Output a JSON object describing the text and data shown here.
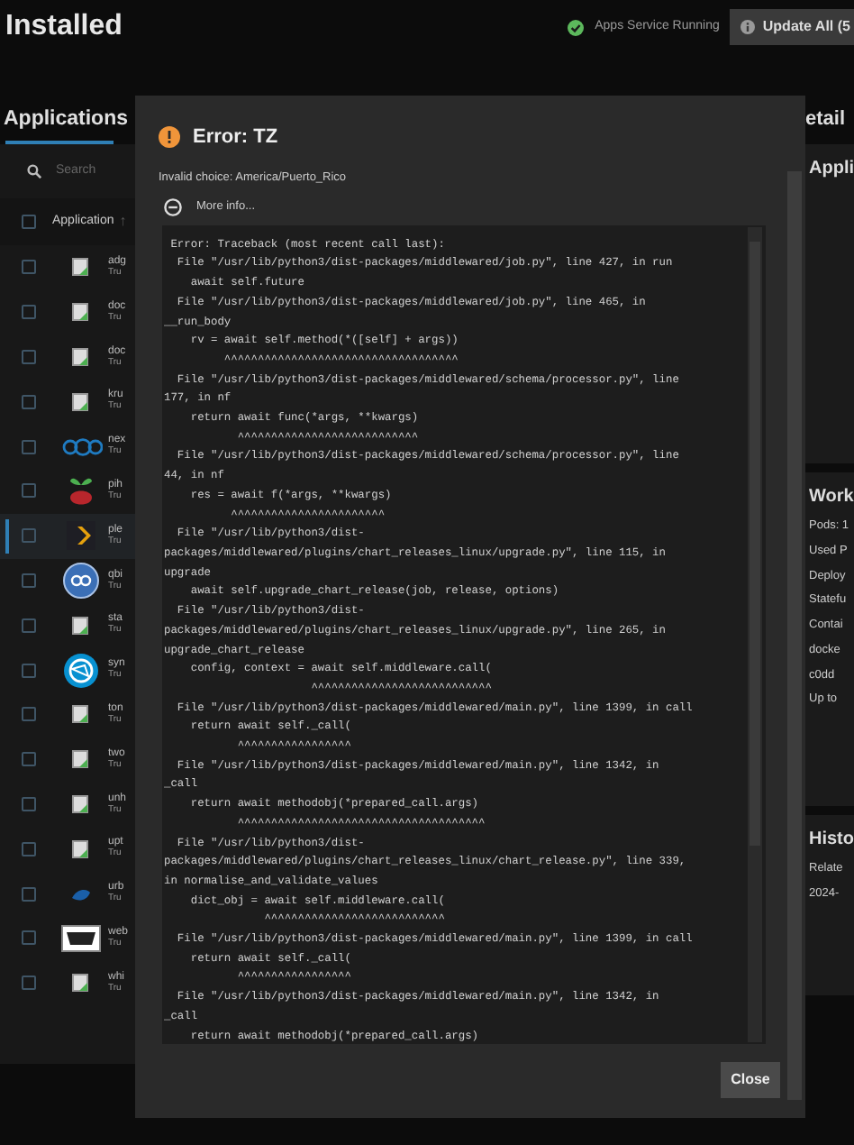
{
  "header": {
    "title": "Installed",
    "service_status": "Apps Service Running",
    "update_button": "Update All (5"
  },
  "applications": {
    "title": "Applications",
    "search": {
      "placeholder": "Search"
    },
    "select_all_checked": false,
    "column": "Application",
    "sort_icon": "↑",
    "rows": [
      {
        "name": "adg",
        "sub": "Tru",
        "kind": "broken",
        "checked": false,
        "selected": false
      },
      {
        "name": "doc",
        "sub": "Tru",
        "kind": "broken",
        "checked": false,
        "selected": false
      },
      {
        "name": "doc",
        "sub": "Tru",
        "kind": "broken",
        "checked": false,
        "selected": false
      },
      {
        "name": "kru",
        "sub": "Tru",
        "kind": "broken",
        "checked": false,
        "selected": false
      },
      {
        "name": "nex",
        "sub": "Tru",
        "kind": "rings",
        "checked": false,
        "selected": false
      },
      {
        "name": "pih",
        "sub": "Tru",
        "kind": "fruit",
        "checked": false,
        "selected": false
      },
      {
        "name": "ple",
        "sub": "Tru",
        "kind": "chevron",
        "checked": false,
        "selected": true
      },
      {
        "name": "qbi",
        "sub": "Tru",
        "kind": "bluecircle",
        "checked": false,
        "selected": false
      },
      {
        "name": "sta",
        "sub": "Tru",
        "kind": "broken",
        "checked": false,
        "selected": false
      },
      {
        "name": "syn",
        "sub": "Tru",
        "kind": "network",
        "checked": false,
        "selected": false
      },
      {
        "name": "ton",
        "sub": "Tru",
        "kind": "broken",
        "checked": false,
        "selected": false
      },
      {
        "name": "two",
        "sub": "Tru",
        "kind": "broken",
        "checked": false,
        "selected": false
      },
      {
        "name": "unh",
        "sub": "Tru",
        "kind": "broken",
        "checked": false,
        "selected": false
      },
      {
        "name": "upt",
        "sub": "Tru",
        "kind": "broken",
        "checked": false,
        "selected": false
      },
      {
        "name": "urb",
        "sub": "Tru",
        "kind": "leaf",
        "checked": false,
        "selected": false
      },
      {
        "name": "web",
        "sub": "Tru",
        "kind": "box",
        "checked": false,
        "selected": false
      },
      {
        "name": "whi",
        "sub": "Tru",
        "kind": "broken",
        "checked": false,
        "selected": false
      }
    ]
  },
  "details": {
    "title": "etail",
    "cards": [
      {
        "title": "Appli"
      },
      {
        "title": "Work",
        "lines": [
          "Pods: 1",
          "Used P",
          "Deploy",
          "Statefu",
          "Contai",
          "docke",
          "c0dd",
          "Up to"
        ]
      },
      {
        "title": "Histo",
        "lines": [
          "Relate",
          "2024-"
        ]
      }
    ]
  },
  "dialog": {
    "title": "Error: TZ",
    "message": "Invalid choice: America/Puerto_Rico",
    "more_info": "More info...",
    "close_button": "Close",
    "traceback": [
      " Error: Traceback (most recent call last):",
      "  File \"/usr/lib/python3/dist-packages/middlewared/job.py\", line 427, in run",
      "    await self.future",
      "  File \"/usr/lib/python3/dist-packages/middlewared/job.py\", line 465, in",
      "__run_body",
      "    rv = await self.method(*([self] + args))",
      "         ^^^^^^^^^^^^^^^^^^^^^^^^^^^^^^^^^^^",
      "  File \"/usr/lib/python3/dist-packages/middlewared/schema/processor.py\", line",
      "177, in nf",
      "    return await func(*args, **kwargs)",
      "           ^^^^^^^^^^^^^^^^^^^^^^^^^^^",
      "  File \"/usr/lib/python3/dist-packages/middlewared/schema/processor.py\", line",
      "44, in nf",
      "    res = await f(*args, **kwargs)",
      "          ^^^^^^^^^^^^^^^^^^^^^^^",
      "  File \"/usr/lib/python3/dist-",
      "packages/middlewared/plugins/chart_releases_linux/upgrade.py\", line 115, in",
      "upgrade",
      "    await self.upgrade_chart_release(job, release, options)",
      "  File \"/usr/lib/python3/dist-",
      "packages/middlewared/plugins/chart_releases_linux/upgrade.py\", line 265, in",
      "upgrade_chart_release",
      "    config, context = await self.middleware.call(",
      "                      ^^^^^^^^^^^^^^^^^^^^^^^^^^^",
      "  File \"/usr/lib/python3/dist-packages/middlewared/main.py\", line 1399, in call",
      "    return await self._call(",
      "           ^^^^^^^^^^^^^^^^^",
      "  File \"/usr/lib/python3/dist-packages/middlewared/main.py\", line 1342, in",
      "_call",
      "    return await methodobj(*prepared_call.args)",
      "           ^^^^^^^^^^^^^^^^^^^^^^^^^^^^^^^^^^^^^",
      "  File \"/usr/lib/python3/dist-",
      "packages/middlewared/plugins/chart_releases_linux/chart_release.py\", line 339,",
      "in normalise_and_validate_values",
      "    dict_obj = await self.middleware.call(",
      "               ^^^^^^^^^^^^^^^^^^^^^^^^^^^",
      "  File \"/usr/lib/python3/dist-packages/middlewared/main.py\", line 1399, in call",
      "    return await self._call(",
      "           ^^^^^^^^^^^^^^^^^",
      "  File \"/usr/lib/python3/dist-packages/middlewared/main.py\", line 1342, in",
      "_call",
      "    return await methodobj(*prepared_call.args)"
    ]
  }
}
